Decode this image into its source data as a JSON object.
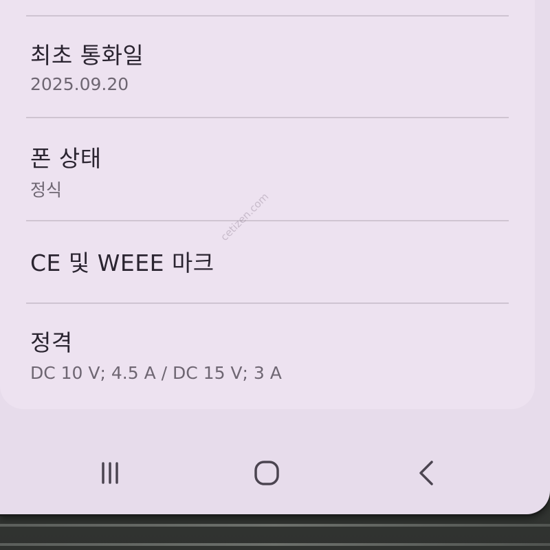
{
  "settings": {
    "items": [
      {
        "title": "최초 통화일",
        "value": "2025.09.20"
      },
      {
        "title": "폰 상태",
        "value": "정식"
      },
      {
        "title": "CE 및 WEEE 마크"
      },
      {
        "title": "정격",
        "value": "DC 10 V; 4.5 A / DC 15 V; 3 A"
      }
    ]
  },
  "watermark": "cetizen.com",
  "navigation": {
    "recent_apps": "recent-apps-icon",
    "home": "home-icon",
    "back": "back-icon"
  },
  "colors": {
    "screen_background": "#e7dceb",
    "card_background": "#ede2f0",
    "title_text": "#2a2430",
    "value_text": "#6e6672",
    "nav_icon": "#4b4450"
  }
}
